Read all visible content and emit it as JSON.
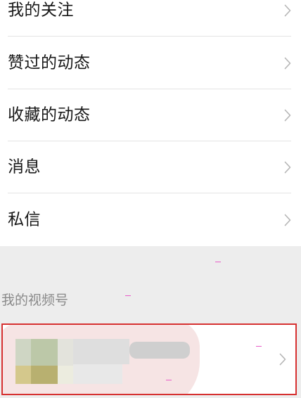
{
  "menu": {
    "items": [
      {
        "label": "我的关注"
      },
      {
        "label": "赞过的动态"
      },
      {
        "label": "收藏的动态"
      },
      {
        "label": "消息"
      },
      {
        "label": "私信"
      }
    ]
  },
  "channels_section": {
    "title": "我的视频号"
  },
  "icons": {
    "chevron": "chevron-right-icon"
  },
  "colors": {
    "page_background": "#ededed",
    "row_background": "#ffffff",
    "highlight_border": "#d63030"
  }
}
